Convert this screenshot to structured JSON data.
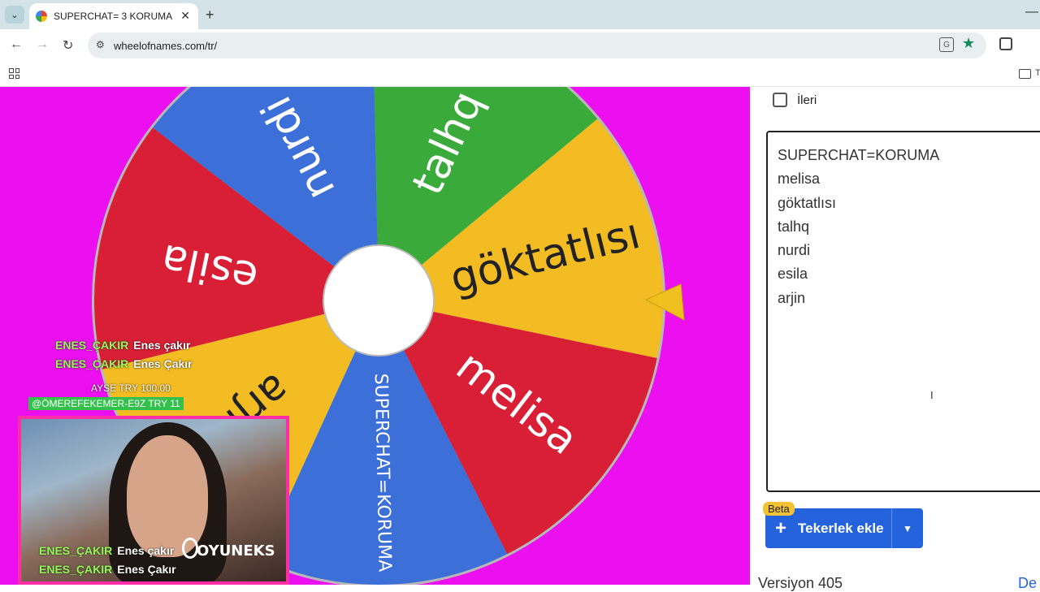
{
  "browser": {
    "tab_title": "SUPERCHAT= 3 KORUMA",
    "url": "wheelofnames.com/tr/",
    "folder_label": "T"
  },
  "wheel": {
    "slices": [
      {
        "label": "göktatlısı",
        "color": "#f2bc22"
      },
      {
        "label": "melisa",
        "color": "#d81f35"
      },
      {
        "label": "SUPERCHAT=KORUMA",
        "color": "#3d6fd8"
      },
      {
        "label": "arjin",
        "color": "#f2bc22"
      },
      {
        "label": "esila",
        "color": "#d81f35"
      },
      {
        "label": "nurdi",
        "color": "#3d6fd8"
      },
      {
        "label": "talhq",
        "color": "#3aaa3a"
      }
    ],
    "pointer_color": "#f0c020",
    "hub_color": "#ffffff"
  },
  "sidebar": {
    "advanced_label": "İleri",
    "entries": [
      "SUPERCHAT=KORUMA",
      "melisa",
      "göktatlısı",
      "talhq",
      "nurdi",
      "esila",
      "arjin"
    ],
    "beta_label": "Beta",
    "add_wheel_label": "Tekerlek ekle",
    "version_text": "Versiyon 405",
    "more_link": "De"
  },
  "stream": {
    "chat": [
      {
        "user": "ENES_ÇAKIR",
        "msg": "Enes çakır"
      },
      {
        "user": "ENES_ÇAKIR",
        "msg": "Enes Çakır"
      }
    ],
    "donation": "AYSE  TRY 100.00",
    "superchat": "@ÖMEREFEKEMER-E9Z  TRY 11",
    "cam_chat": [
      {
        "user": "ENES_ÇAKIR",
        "msg": "Enes çakır"
      },
      {
        "user": "ENES_ÇAKIR",
        "msg": "Enes Çakır"
      }
    ],
    "logo": "OYUNEKS"
  }
}
